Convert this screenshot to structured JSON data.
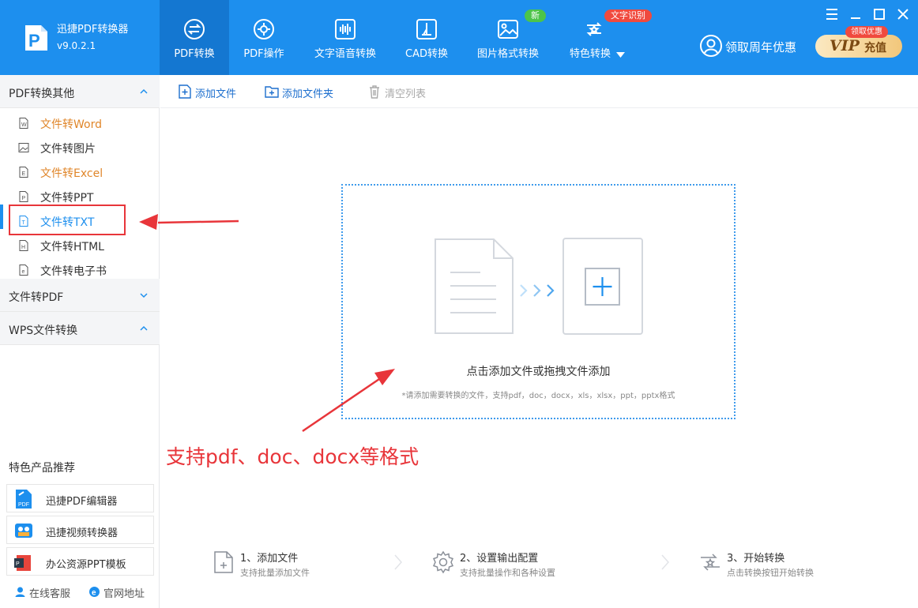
{
  "colors": {
    "header": "#1d8fee",
    "active_nav": "#1477d1",
    "accent": "#1d8fee",
    "annotation": "#e8353a",
    "orange_text": "#e0862a"
  },
  "app": {
    "name": "迅捷PDF转换器",
    "version": "v9.0.2.1"
  },
  "nav": [
    {
      "label": "PDF转换",
      "icon": "pdf-convert-icon",
      "active": true
    },
    {
      "label": "PDF操作",
      "icon": "pdf-operation-icon"
    },
    {
      "label": "文字语音转换",
      "icon": "audio-wave-icon"
    },
    {
      "label": "CAD转换",
      "icon": "cad-icon"
    },
    {
      "label": "图片格式转换",
      "icon": "image-icon",
      "badge": "新"
    },
    {
      "label": "特色转换",
      "icon": "special-convert-icon",
      "badge": "文字识别"
    }
  ],
  "header": {
    "promo": "领取周年优惠",
    "vip_word": "VIP",
    "vip_suffix": "充值",
    "vip_badge": "领取优惠"
  },
  "sidebar": {
    "sections": [
      {
        "title": "PDF转换其他",
        "expanded": true
      },
      {
        "title": "文件转PDF",
        "expanded": false
      },
      {
        "title": "WPS文件转换",
        "expanded": true
      }
    ],
    "items": [
      {
        "label": "文件转Word",
        "letter": "W"
      },
      {
        "label": "文件转图片",
        "letter": ""
      },
      {
        "label": "文件转Excel",
        "letter": "E"
      },
      {
        "label": "文件转PPT",
        "letter": "P"
      },
      {
        "label": "文件转TXT",
        "letter": "T",
        "active": true
      },
      {
        "label": "文件转HTML",
        "letter": "H"
      },
      {
        "label": "文件转电子书",
        "letter": "e"
      }
    ],
    "featured_title": "特色产品推荐",
    "featured": [
      {
        "label": "迅捷PDF编辑器",
        "icon": "pdf-editor-icon"
      },
      {
        "label": "迅捷视频转换器",
        "icon": "video-converter-icon"
      },
      {
        "label": "办公资源PPT模板",
        "icon": "ppt-template-icon"
      }
    ],
    "footer": [
      {
        "label": "在线客服",
        "icon": "customer-service-icon"
      },
      {
        "label": "官网地址",
        "icon": "browser-icon"
      }
    ]
  },
  "toolbar": {
    "add_file": "添加文件",
    "add_folder": "添加文件夹",
    "clear_list": "清空列表"
  },
  "dropzone": {
    "title": "点击添加文件或拖拽文件添加",
    "subtitle": "*请添加需要转换的文件，支持pdf，doc，docx，xls，xlsx，ppt，pptx格式"
  },
  "annotation": "支持pdf、doc、docx等格式",
  "steps": [
    {
      "title": "1、添加文件",
      "desc": "支持批量添加文件"
    },
    {
      "title": "2、设置输出配置",
      "desc": "支持批量操作和各种设置"
    },
    {
      "title": "3、开始转换",
      "desc": "点击转换按钮开始转换"
    }
  ]
}
